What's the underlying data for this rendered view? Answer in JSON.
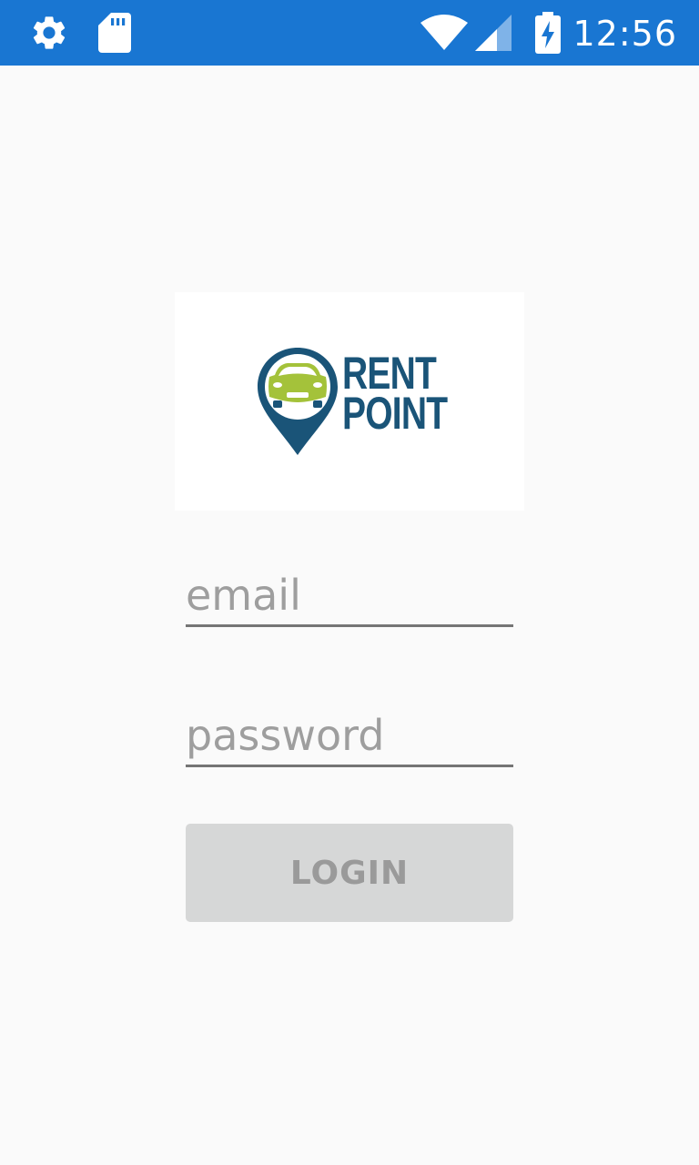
{
  "status_bar": {
    "time": "12:56",
    "icons": [
      "settings-icon",
      "sd-card-icon",
      "wifi-icon",
      "cellular-signal-icon",
      "battery-charging-icon"
    ],
    "background_color": "#1976d2",
    "icon_color": "#ffffff"
  },
  "logo": {
    "line1": "RENT",
    "line2": "POINT",
    "primary_color": "#1a5478",
    "accent_color": "#a4c23a"
  },
  "form": {
    "email_placeholder": "email",
    "email_value": "",
    "password_placeholder": "password",
    "password_value": "",
    "login_label": "LOGIN",
    "login_enabled": false
  },
  "colors": {
    "page_background": "#fafafa",
    "button_background": "#d6d7d7",
    "button_text": "#9a9a9a",
    "placeholder_text": "#9e9e9e",
    "underline": "#757575"
  }
}
